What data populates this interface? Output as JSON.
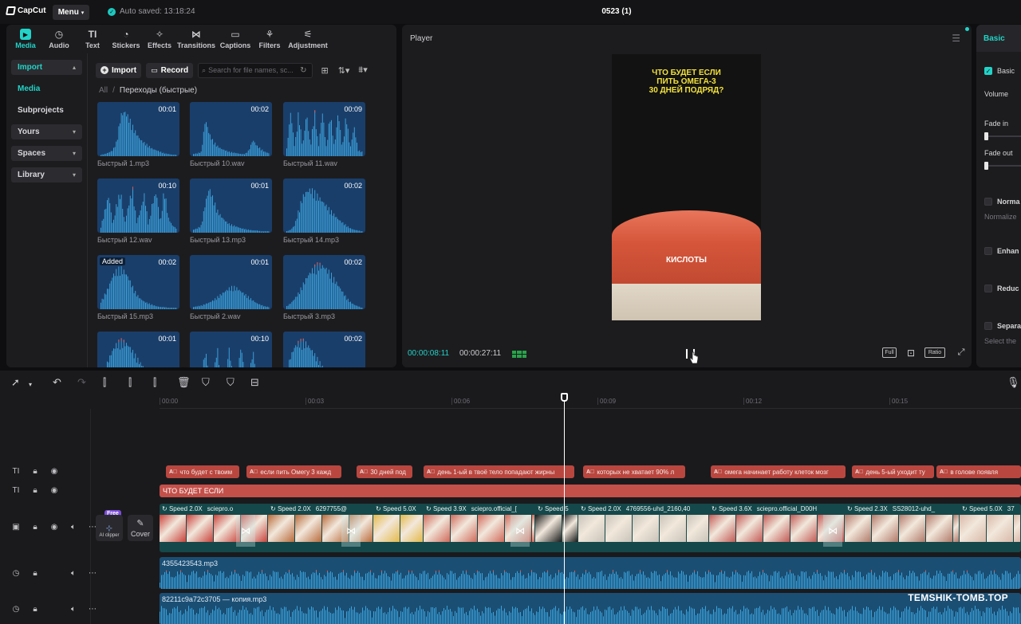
{
  "app": {
    "logo_text": "CapCut",
    "menu_label": "Menu",
    "autosave_text": "Auto saved: 13:18:24",
    "project_title": "0523 (1)"
  },
  "tool_tabs": [
    {
      "label": "Media",
      "icon": "media-icon",
      "active": true
    },
    {
      "label": "Audio",
      "icon": "audio-icon"
    },
    {
      "label": "Text",
      "icon": "text-icon"
    },
    {
      "label": "Stickers",
      "icon": "stickers-icon"
    },
    {
      "label": "Effects",
      "icon": "effects-icon"
    },
    {
      "label": "Transitions",
      "icon": "transitions-icon"
    },
    {
      "label": "Captions",
      "icon": "captions-icon"
    },
    {
      "label": "Filters",
      "icon": "filters-icon"
    },
    {
      "label": "Adjustment",
      "icon": "adjustment-icon"
    }
  ],
  "side_nav": {
    "import": "Import",
    "media": "Media",
    "subprojects": "Subprojects",
    "yours": "Yours",
    "spaces": "Spaces",
    "library": "Library"
  },
  "media_toolbar": {
    "import_label": "Import",
    "record_label": "Record",
    "search_placeholder": "Search for file names, sc..."
  },
  "breadcrumb": {
    "all": "All",
    "current": "Переходы (быстрые)"
  },
  "media_items": [
    {
      "name": "Быстрый 1.mp3",
      "duration": "00:01",
      "badge": ""
    },
    {
      "name": "Быстрый 10.wav",
      "duration": "00:02",
      "badge": ""
    },
    {
      "name": "Быстрый 11.wav",
      "duration": "00:09",
      "badge": ""
    },
    {
      "name": "Быстрый 12.wav",
      "duration": "00:10",
      "badge": ""
    },
    {
      "name": "Быстрый 13.mp3",
      "duration": "00:01",
      "badge": ""
    },
    {
      "name": "Быстрый 14.mp3",
      "duration": "00:02",
      "badge": ""
    },
    {
      "name": "Быстрый 15.mp3",
      "duration": "00:02",
      "badge": "Added"
    },
    {
      "name": "Быстрый 2.wav",
      "duration": "00:01",
      "badge": ""
    },
    {
      "name": "Быстрый 3.mp3",
      "duration": "00:02",
      "badge": ""
    },
    {
      "name": "",
      "duration": "00:01",
      "badge": ""
    },
    {
      "name": "",
      "duration": "00:10",
      "badge": ""
    },
    {
      "name": "",
      "duration": "00:02",
      "badge": ""
    }
  ],
  "player": {
    "title": "Player",
    "caption_line1": "ЧТО БУДЕТ ЕСЛИ",
    "caption_line2": "ПИТЬ ОМЕГА-3",
    "caption_line3": "30 ДНЕЙ ПОДРЯД?",
    "subtitle": "КИСЛОТЫ",
    "time_current": "00:00:08:11",
    "time_total": "00:00:27:11",
    "full_label": "Full",
    "ratio_label": "Ratio"
  },
  "right_panel": {
    "tab": "Basic",
    "basic_label": "Basic",
    "volume": "Volume",
    "fade_in": "Fade in",
    "fade_out": "Fade out",
    "normalize": "Norma",
    "normalize_sub": "Normalize",
    "enhance": "Enhan",
    "reduce": "Reduc",
    "separate": "Separa",
    "separate_sub": "Select the"
  },
  "timeline": {
    "ruler_labels": [
      "00:00",
      "00:03",
      "00:06",
      "00:09",
      "00:12",
      "00:15"
    ],
    "text_clips": [
      {
        "text": "что будет с твоим"
      },
      {
        "text": "если пить Омегу 3 кажд"
      },
      {
        "text": "30 дней под"
      },
      {
        "text": "день 1-ый в твоё тело попадают жирны"
      },
      {
        "text": "которых не хватает 90% л"
      },
      {
        "text": "омега начинает работу клеток мозг"
      },
      {
        "text": "день 5-ый уходит ту"
      },
      {
        "text": "в голове появля"
      }
    ],
    "title_clip": "ЧТО БУДЕТ ЕСЛИ",
    "video_clips": [
      {
        "speed": "Speed 2.0X",
        "name": "sciepro.o"
      },
      {
        "speed": "Speed 2.0X",
        "name": "6297755@"
      },
      {
        "speed": "Speed 5.0X",
        "name": ""
      },
      {
        "speed": "Speed 3.9X",
        "name": "sciepro.official_["
      },
      {
        "speed": "Speed 5",
        "name": ""
      },
      {
        "speed": "Speed 2.0X",
        "name": "4769556-uhd_2160,40"
      },
      {
        "speed": "Speed 3.6X",
        "name": "sciepro.official_D00H"
      },
      {
        "speed": "Speed 2.3X",
        "name": "SS28012-uhd_"
      },
      {
        "speed": "Speed 5.0X",
        "name": "37"
      }
    ],
    "free_badge": "Free",
    "clipper_label": "AI clipper",
    "cover_label": "Cover",
    "audio1": "4355423543.mp3",
    "audio2": "82211c9a72c3705 — копия.mp3"
  },
  "watermark": "TEMSHIK-TOMB.TOP",
  "colors": {
    "accent": "#22d3c8",
    "text_clip": "#b9473f",
    "video_track": "#15484a",
    "audio_track": "#1b4e73"
  }
}
